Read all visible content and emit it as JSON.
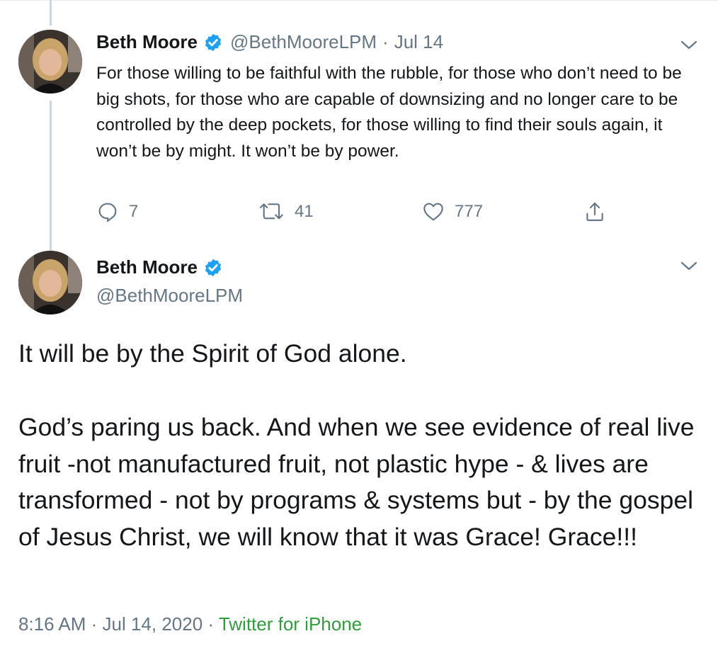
{
  "parent_tweet": {
    "author": {
      "display_name": "Beth Moore",
      "handle": "@BethMooreLPM",
      "verified": true,
      "avatar_icon": "avatar-photo"
    },
    "separator": "·",
    "date": "Jul 14",
    "text": "For those willing to be faithful with the rubble, for those who don’t need to be big shots, for those who are capable of downsizing and no longer care to be controlled by the deep pockets, for those willing to find their souls again, it won’t be by might. It won’t be by power.",
    "actions": {
      "replies": "7",
      "retweets": "41",
      "likes": "777"
    },
    "menu_icon": "chevron-down-icon"
  },
  "main_tweet": {
    "author": {
      "display_name": "Beth Moore",
      "handle": "@BethMooreLPM",
      "verified": true
    },
    "paragraphs": [
      "It will be by the Spirit of God alone.",
      "God’s paring us back. And when we see evidence of real live fruit -not manufactured fruit, not plastic hype - & lives are transformed - not by programs & systems but - by the gospel of Jesus Christ, we will know that it was Grace! Grace!!!"
    ],
    "timestamp": {
      "time": "8:16 AM",
      "separator": " · ",
      "date": "Jul 14, 2020",
      "source": "Twitter for iPhone"
    },
    "menu_icon": "chevron-down-icon"
  },
  "colors": {
    "text": "#14171a",
    "muted": "#657786",
    "verified_blue": "#1da1f2",
    "thread_line": "#ccd6dd",
    "source_green": "#2e9e3a"
  }
}
